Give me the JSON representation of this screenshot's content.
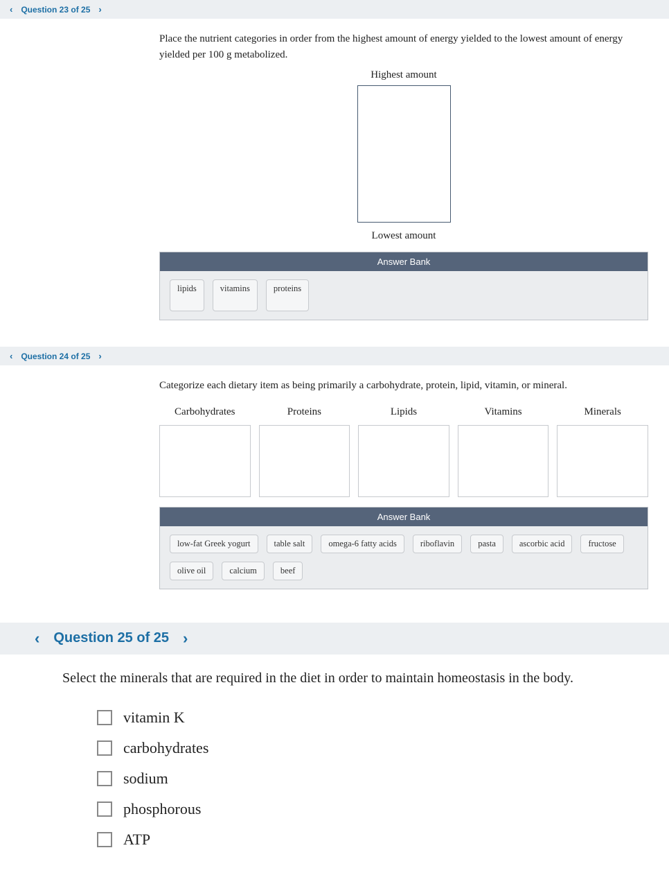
{
  "q23": {
    "nav_label": "Question 23 of 25",
    "prompt": "Place the nutrient categories in order from the highest amount of energy yielded to the lowest amount of energy yielded per 100 g metabolized.",
    "top_label": "Highest amount",
    "bottom_label": "Lowest amount",
    "bank_header": "Answer Bank",
    "chips": [
      "lipids",
      "vitamins",
      "proteins"
    ]
  },
  "q24": {
    "nav_label": "Question 24 of 25",
    "prompt": "Categorize each dietary item as being primarily a carbohydrate, protein, lipid, vitamin, or mineral.",
    "categories": [
      "Carbohydrates",
      "Proteins",
      "Lipids",
      "Vitamins",
      "Minerals"
    ],
    "bank_header": "Answer Bank",
    "chips_row1": [
      "low-fat Greek yogurt",
      "table salt",
      "omega-6 fatty acids",
      "riboflavin",
      "pasta",
      "ascorbic acid",
      "fructose"
    ],
    "chips_row2": [
      "olive oil",
      "calcium",
      "beef"
    ]
  },
  "q25": {
    "nav_label": "Question 25 of 25",
    "prompt": "Select the minerals that are required in the diet in order to maintain homeostasis in the body.",
    "options": [
      "vitamin K",
      "carbohydrates",
      "sodium",
      "phosphorous",
      "ATP"
    ]
  }
}
